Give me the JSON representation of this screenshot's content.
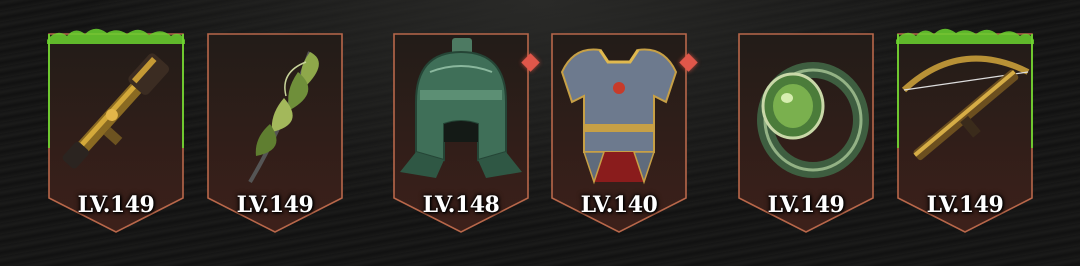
{
  "equipment": [
    {
      "slot_name": "weapon-rifle-slot",
      "level": "LV.149",
      "glow": "#6bd42f",
      "icon": "rifle-icon",
      "gem": false
    },
    {
      "slot_name": "leaf-charm-slot",
      "level": "LV.149",
      "glow": null,
      "icon": "leaf-charm-icon",
      "gem": false
    },
    {
      "slot_name": "helmet-slot",
      "level": "LV.148",
      "glow": null,
      "icon": "helmet-icon",
      "gem": true
    },
    {
      "slot_name": "chest-armor-slot",
      "level": "LV.140",
      "glow": null,
      "icon": "chest-armor-icon",
      "gem": true
    },
    {
      "slot_name": "ring-slot",
      "level": "LV.149",
      "glow": null,
      "icon": "ring-icon",
      "gem": false
    },
    {
      "slot_name": "crossbow-slot",
      "level": "LV.149",
      "glow": "#6bd42f",
      "icon": "crossbow-icon",
      "gem": false
    }
  ],
  "colors": {
    "frame_border": "#b8674a",
    "frame_fill_top": "#201a17",
    "frame_fill_bottom": "#3a1f1a",
    "gem": "#e0574a",
    "aura_green": "#6bd42f"
  }
}
